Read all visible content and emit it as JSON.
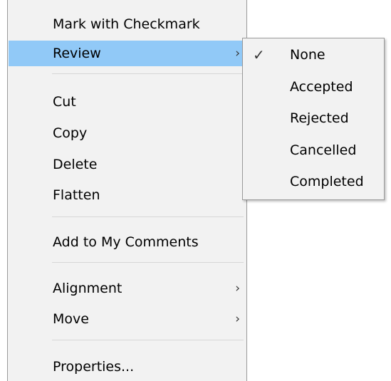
{
  "context_menu": {
    "items": [
      {
        "label": "Mark with Checkmark"
      },
      {
        "label": "Review",
        "submenu_indicator": "›",
        "highlighted": true
      },
      {
        "label": "Cut"
      },
      {
        "label": "Copy"
      },
      {
        "label": "Delete"
      },
      {
        "label": "Flatten"
      },
      {
        "label": "Add to My Comments"
      },
      {
        "label": "Alignment",
        "submenu_indicator": "›"
      },
      {
        "label": "Move",
        "submenu_indicator": "›"
      },
      {
        "label": "Properties..."
      }
    ],
    "highlight_color": "#91c9f7",
    "background_color": "#f2f2f2"
  },
  "review_submenu": {
    "items": [
      {
        "label": "None",
        "checked": true,
        "check_glyph": "✓"
      },
      {
        "label": "Accepted"
      },
      {
        "label": "Rejected"
      },
      {
        "label": "Cancelled"
      },
      {
        "label": "Completed"
      }
    ]
  }
}
